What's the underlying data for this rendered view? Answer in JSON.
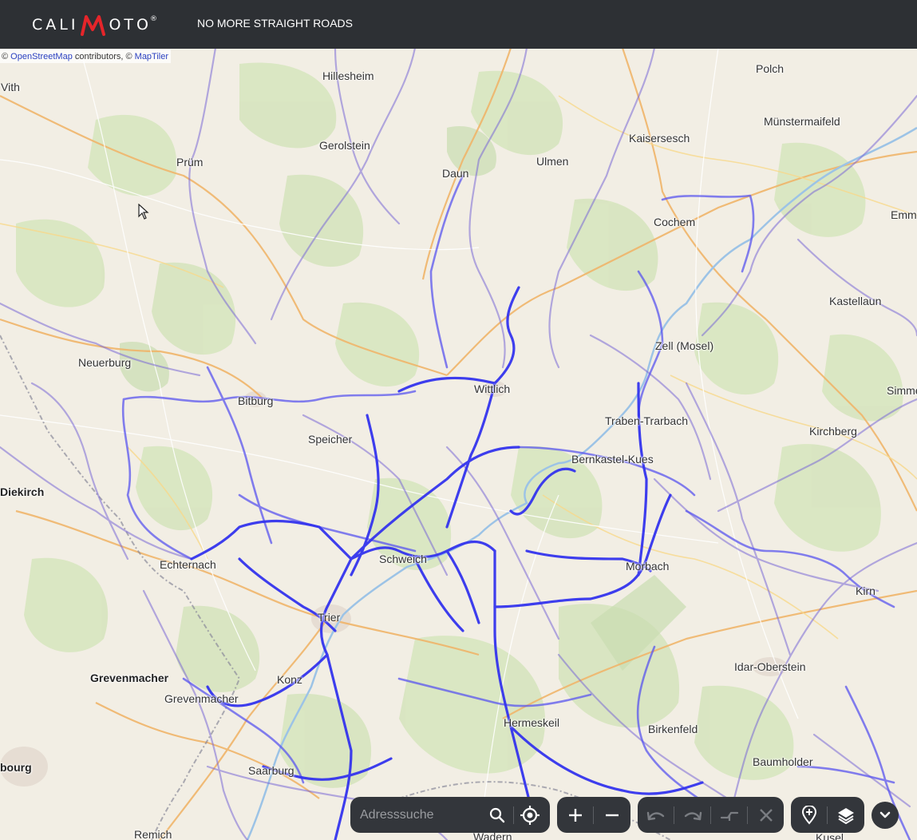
{
  "header": {
    "logo_left": "CALI",
    "logo_right": "OTO",
    "logo_mark": "®",
    "tagline": "NO MORE STRAIGHT ROADS"
  },
  "attribution": {
    "prefix": "©",
    "osm_link": "OpenStreetMap",
    "middle": "contributors, ©",
    "maptiler_link": "MapTiler"
  },
  "places": [
    {
      "name": "Vith",
      "major": false
    },
    {
      "name": "Hillesheim",
      "major": false
    },
    {
      "name": "Polch",
      "major": false
    },
    {
      "name": "Münstermaifeld",
      "major": false
    },
    {
      "name": "Gerolstein",
      "major": false
    },
    {
      "name": "Kaisersesch",
      "major": false
    },
    {
      "name": "Prüm",
      "major": false
    },
    {
      "name": "Daun",
      "major": false
    },
    {
      "name": "Ulmen",
      "major": false
    },
    {
      "name": "Emm",
      "major": false
    },
    {
      "name": "Cochem",
      "major": false
    },
    {
      "name": "Kastellaun",
      "major": false
    },
    {
      "name": "Zell (Mosel)",
      "major": false
    },
    {
      "name": "Neuerburg",
      "major": false
    },
    {
      "name": "Wittlich",
      "major": false
    },
    {
      "name": "Simme",
      "major": false
    },
    {
      "name": "Bitburg",
      "major": false
    },
    {
      "name": "Traben-Trarbach",
      "major": false
    },
    {
      "name": "Kirchberg",
      "major": false
    },
    {
      "name": "Speicher",
      "major": false
    },
    {
      "name": "Bernkastel-Kues",
      "major": false
    },
    {
      "name": "Diekirch",
      "major": true
    },
    {
      "name": "Echternach",
      "major": false
    },
    {
      "name": "Schweich",
      "major": false
    },
    {
      "name": "Morbach",
      "major": false
    },
    {
      "name": "Kirn",
      "major": false
    },
    {
      "name": "Trier",
      "major": false
    },
    {
      "name": "Idar-Oberstein",
      "major": false
    },
    {
      "name": "Grevenmacher",
      "major": true
    },
    {
      "name": "Konz",
      "major": false
    },
    {
      "name": "Grevenmacher",
      "major": false
    },
    {
      "name": "Hermeskeil",
      "major": false
    },
    {
      "name": "Birkenfeld",
      "major": false
    },
    {
      "name": "Baumholder",
      "major": false
    },
    {
      "name": "bourg",
      "major": true
    },
    {
      "name": "Saarburg",
      "major": false
    },
    {
      "name": "Remich",
      "major": false
    },
    {
      "name": "Wadern",
      "major": false
    },
    {
      "name": "Kusel",
      "major": false
    }
  ],
  "controls": {
    "search_placeholder": "Adresssuche",
    "search_value": ""
  },
  "icons": [
    "search-icon",
    "locate-icon",
    "zoom-in-icon",
    "zoom-out-icon",
    "undo-icon",
    "redo-icon",
    "split-route-icon",
    "clear-route-icon",
    "add-waypoint-icon",
    "layers-icon",
    "chevron-down-icon"
  ],
  "colors": {
    "header_bg": "#2d3034",
    "route": "#3a3aff",
    "control_bg": "#33363b"
  }
}
